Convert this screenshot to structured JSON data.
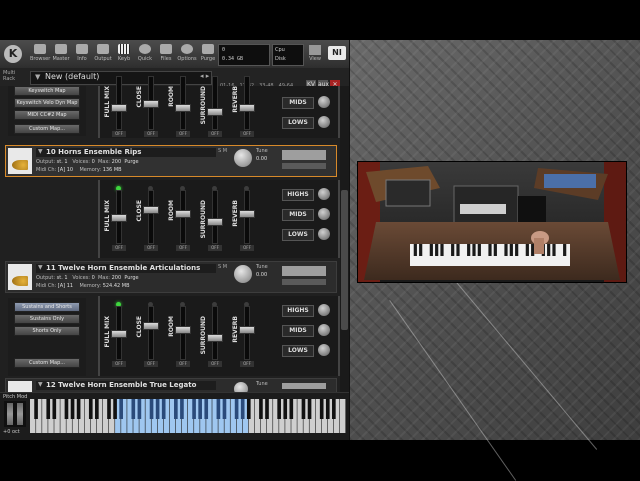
{
  "toolbar": {
    "buttons": [
      {
        "label": "Browser",
        "icon": "folder-icon"
      },
      {
        "label": "Master",
        "icon": "sliders-icon"
      },
      {
        "label": "Info",
        "icon": "info-icon"
      },
      {
        "label": "Output",
        "icon": "output-icon"
      },
      {
        "label": "Keyb",
        "icon": "keyboard-icon"
      },
      {
        "label": "Quick",
        "icon": "quick-icon"
      },
      {
        "label": "Files",
        "icon": "files-icon"
      },
      {
        "label": "Options",
        "icon": "gear-icon"
      },
      {
        "label": "Purge",
        "icon": "purge-icon"
      }
    ],
    "display_voices": "0",
    "display_memory": "0.34 GB",
    "cpu_label": "Cpu",
    "disk_label": "Disk",
    "view_label": "View",
    "ni_logo": "NI"
  },
  "rack": {
    "label": "Multi Rack",
    "preset_name": "New (default)",
    "ranges": [
      "01-16",
      "17-32",
      "33-48",
      "49-64"
    ],
    "icons": [
      {
        "name": "kv-icon",
        "text": "KV"
      },
      {
        "name": "aux-icon",
        "text": "aux"
      },
      {
        "name": "close-icon",
        "text": "✕"
      }
    ]
  },
  "keyswitch_top": [
    "Keyswitch Map",
    "Keyswitch Velo Dyn Map",
    "MIDI CC#2 Map",
    "Custom Map..."
  ],
  "keyswitch_bottom": [
    "Sustains and Shorts",
    "Sustains Only",
    "Shorts Only",
    "Custom Map..."
  ],
  "instruments": [
    {
      "title": "10 Horns Ensemble Rips",
      "output": "st. 1",
      "voices": "0",
      "max": "200",
      "purge": "Purge",
      "midi_ch": "[A] 10",
      "memory": "136 MB",
      "tune_label": "Tune",
      "tune_value": "0.00"
    },
    {
      "title": "11 Twelve Horn Ensemble Articulations",
      "output": "st. 1",
      "voices": "0",
      "max": "200",
      "purge": "Purge",
      "midi_ch": "[A] 11",
      "memory": "524.42 MB",
      "tune_label": "Tune",
      "tune_value": "0.00"
    },
    {
      "title": "12 Twelve Horn Ensemble True Legato",
      "tune_label": "Tune"
    }
  ],
  "instrument_labels": {
    "output": "Output:",
    "voices": "Voices:",
    "max": "Max:",
    "midi": "Midi Ch:",
    "memory": "Memory:",
    "solo": "S",
    "mute": "M"
  },
  "mixer": {
    "faders": [
      "FULL MIX",
      "CLOSE",
      "ROOM",
      "SURROUND",
      "REVERB"
    ],
    "off_label": "OFF",
    "eq": [
      "HIGHS",
      "MIDS",
      "LOWS"
    ]
  },
  "keyboard": {
    "pitch_label": "Pitch Mod",
    "octave_label": "+0 oct"
  },
  "colors": {
    "selected_border": "#d88a2a",
    "led_on": "#3ed63e",
    "key_highlight": "#9fc7f0"
  }
}
